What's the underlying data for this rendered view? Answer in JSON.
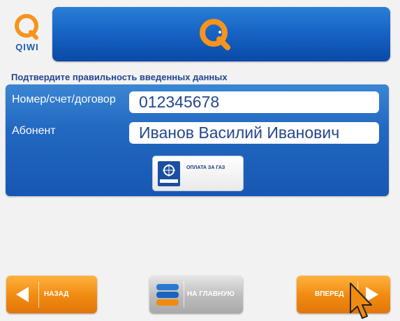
{
  "brand": {
    "name": "QIWI"
  },
  "header": {
    "title": "Подтвердите правильность введенных данных"
  },
  "fields": [
    {
      "label": "Номер/счет/договор",
      "value": "012345678"
    },
    {
      "label": "Абонент",
      "value": "Иванов Василий Иванович"
    }
  ],
  "service": {
    "label": "ОПЛАТА ЗА ГАЗ"
  },
  "nav": {
    "back_label": "НАЗАД",
    "home_label": "НА ГЛАВНУЮ",
    "forward_label": "ВПЕРЕД"
  },
  "colors": {
    "banner_blue": "#1764c6",
    "panel_blue": "#2268c1",
    "accent_orange": "#f08a10",
    "title_blue": "#24468f"
  },
  "icons": [
    "qiwi-logo-icon",
    "qiwi-banner-logo-icon",
    "gas-company-logo-icon",
    "arrow-left-icon",
    "arrow-right-icon",
    "home-stack-icon",
    "cursor-arrow-icon"
  ]
}
